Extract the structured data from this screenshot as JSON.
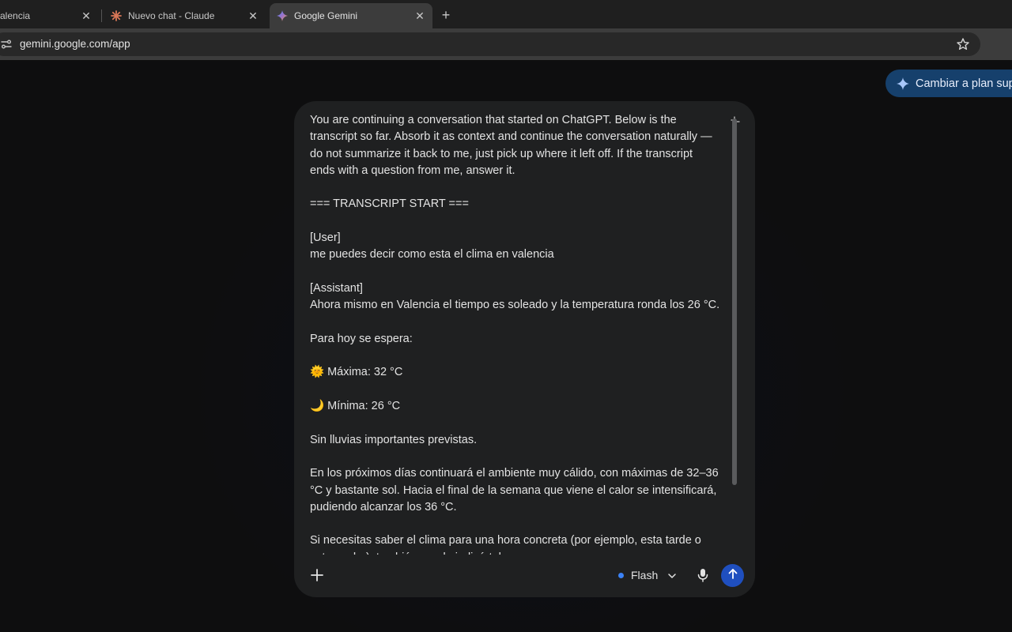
{
  "browser": {
    "tabs": [
      {
        "title": "alencia",
        "active": false
      },
      {
        "title": "Nuevo chat - Claude",
        "active": false
      },
      {
        "title": "Google Gemini",
        "active": true
      }
    ],
    "close_glyph": "✕",
    "new_tab_glyph": "+",
    "url": "gemini.google.com/app"
  },
  "page": {
    "upgrade_label": "Cambiar a plan superior",
    "composer": {
      "lines": [
        "You are continuing a conversation that started on ChatGPT. Below is the",
        "transcript so far. Absorb it as context and continue the conversation naturally —",
        "do not summarize it back to me, just pick up where it left off. If the transcript",
        "ends with a question from me, answer it.",
        "",
        "=== TRANSCRIPT START ===",
        "",
        "[User]",
        "me puedes decir como esta el clima en valencia",
        "",
        "[Assistant]",
        "Ahora mismo en Valencia el tiempo es soleado y la temperatura ronda los 26 °C.",
        "",
        "Para hoy se espera:",
        "",
        "🌞 Máxima: 32 °C",
        "",
        "🌙 Mínima: 26 °C",
        "",
        "Sin lluvias importantes previstas.",
        "",
        "En los próximos días continuará el ambiente muy cálido, con máximas de 32–36",
        "°C y bastante sol. Hacia el final de la semana que viene el calor se intensificará,",
        "pudiendo alcanzar los 36 °C.",
        "",
        "Si necesitas saber el clima para una hora concreta (por ejemplo, esta tarde o",
        "esta noche), también puedo indicártelo."
      ],
      "model_label": "Flash"
    }
  },
  "colors": {
    "accent": "#1f4fbf",
    "upgrade_bg": "#16406c",
    "model_dot": "#3b82f6"
  }
}
